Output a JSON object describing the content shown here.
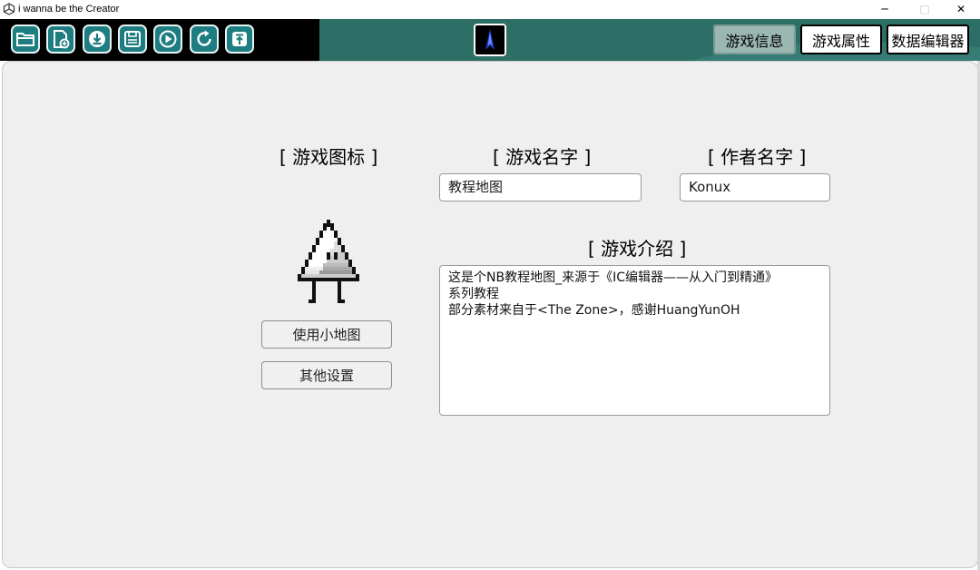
{
  "window": {
    "title": "i wanna be the Creator",
    "min_glyph": "─",
    "max_glyph": "□",
    "close_glyph": "✕"
  },
  "toolbar": {
    "buttons": [
      {
        "name": "open-folder-button",
        "icon": "folder-icon"
      },
      {
        "name": "new-file-button",
        "icon": "new-file-icon"
      },
      {
        "name": "download-button",
        "icon": "download-icon"
      },
      {
        "name": "save-button",
        "icon": "save-icon"
      },
      {
        "name": "play-button",
        "icon": "play-icon"
      },
      {
        "name": "refresh-button",
        "icon": "refresh-icon"
      },
      {
        "name": "upload-button",
        "icon": "upload-icon"
      }
    ],
    "tabs": [
      {
        "label": "游戏信息",
        "active": true
      },
      {
        "label": "游戏属性",
        "active": false
      },
      {
        "label": "数据编辑器",
        "active": false
      }
    ],
    "accent_color": "#1e7d80",
    "teal_color": "#2d6f67"
  },
  "game_icon_section": {
    "heading": "[ 游戏图标 ]",
    "minimap_button": "使用小地图",
    "other_settings_button": "其他设置"
  },
  "game_name": {
    "heading": "[ 游戏名字 ]",
    "value": "教程地图"
  },
  "author_name": {
    "heading": "[ 作者名字 ]",
    "value": "Konux"
  },
  "description": {
    "heading": "[ 游戏介绍 ]",
    "lines": [
      "这是个NB教程地图_来源于《IC编辑器——从入门到精通》",
      "系列教程",
      "部分素材来自于<The Zone>，感谢HuangYunOH"
    ]
  }
}
